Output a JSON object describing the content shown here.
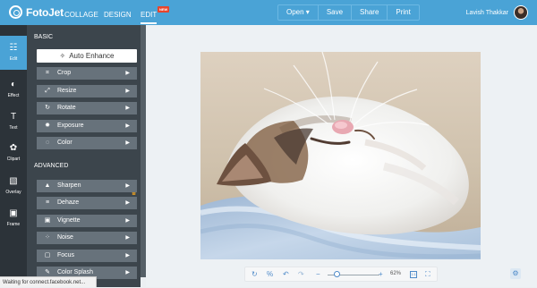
{
  "app": {
    "logo_text": "FotoJet",
    "nav": [
      "COLLAGE",
      "DESIGN",
      "EDIT"
    ],
    "new_badge": "NEW",
    "actions": [
      "Open ▾",
      "Save",
      "Share",
      "Print"
    ],
    "user_name": "Lavish Thakkar"
  },
  "toolbar": [
    {
      "label": "Edit",
      "icon": "sliders-icon"
    },
    {
      "label": "Effect",
      "icon": "effect-icon"
    },
    {
      "label": "Text",
      "icon": "text-icon"
    },
    {
      "label": "Clipart",
      "icon": "clipart-icon"
    },
    {
      "label": "Overlay",
      "icon": "overlay-icon"
    },
    {
      "label": "Frame",
      "icon": "frame-icon"
    }
  ],
  "panel": {
    "basic_title": "BASIC",
    "auto_enhance": "Auto Enhance",
    "basic_items": [
      "Crop",
      "Resize",
      "Rotate",
      "Exposure",
      "Color"
    ],
    "advanced_title": "ADVANCED",
    "advanced_items": [
      "Sharpen",
      "Dehaze",
      "Vignette",
      "Noise",
      "Focus",
      "Color Splash"
    ]
  },
  "zoom": {
    "percent": "62%",
    "value": 0.62
  },
  "status": "Waiting for connect.facebook.net..."
}
